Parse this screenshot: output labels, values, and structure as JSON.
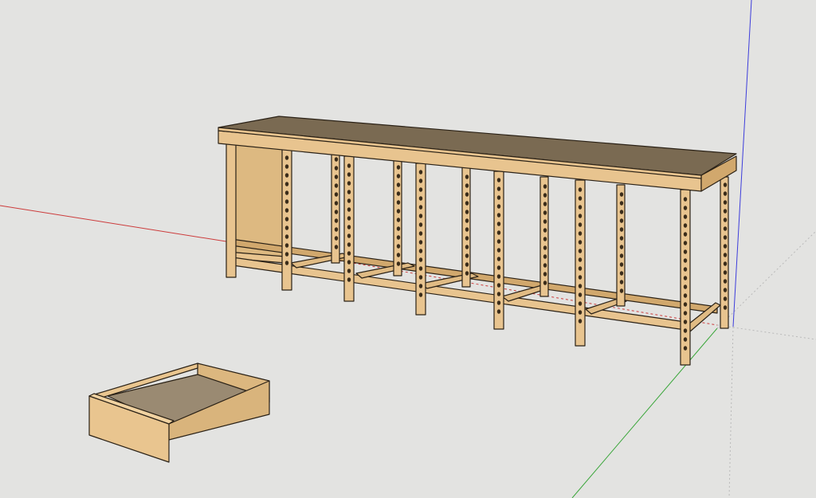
{
  "viewport": {
    "background": "#e3e3e1",
    "axis_colors": {
      "red": "#cc3b3b",
      "green": "#3aa63a",
      "blue": "#3d3ddb"
    }
  },
  "model": {
    "bench": {
      "part_color": "#e8c48f",
      "part_shade": "#d1a86d",
      "top_surface_color": "#7a6a52",
      "edge_color": "#2a2116",
      "leg_count": 11,
      "bays": 6
    },
    "drawer": {
      "part_color": "#e9c58f",
      "inner_color": "#9a8a72",
      "edge_color": "#2a2116"
    },
    "peg_hole_color": "#3a2c1a"
  }
}
